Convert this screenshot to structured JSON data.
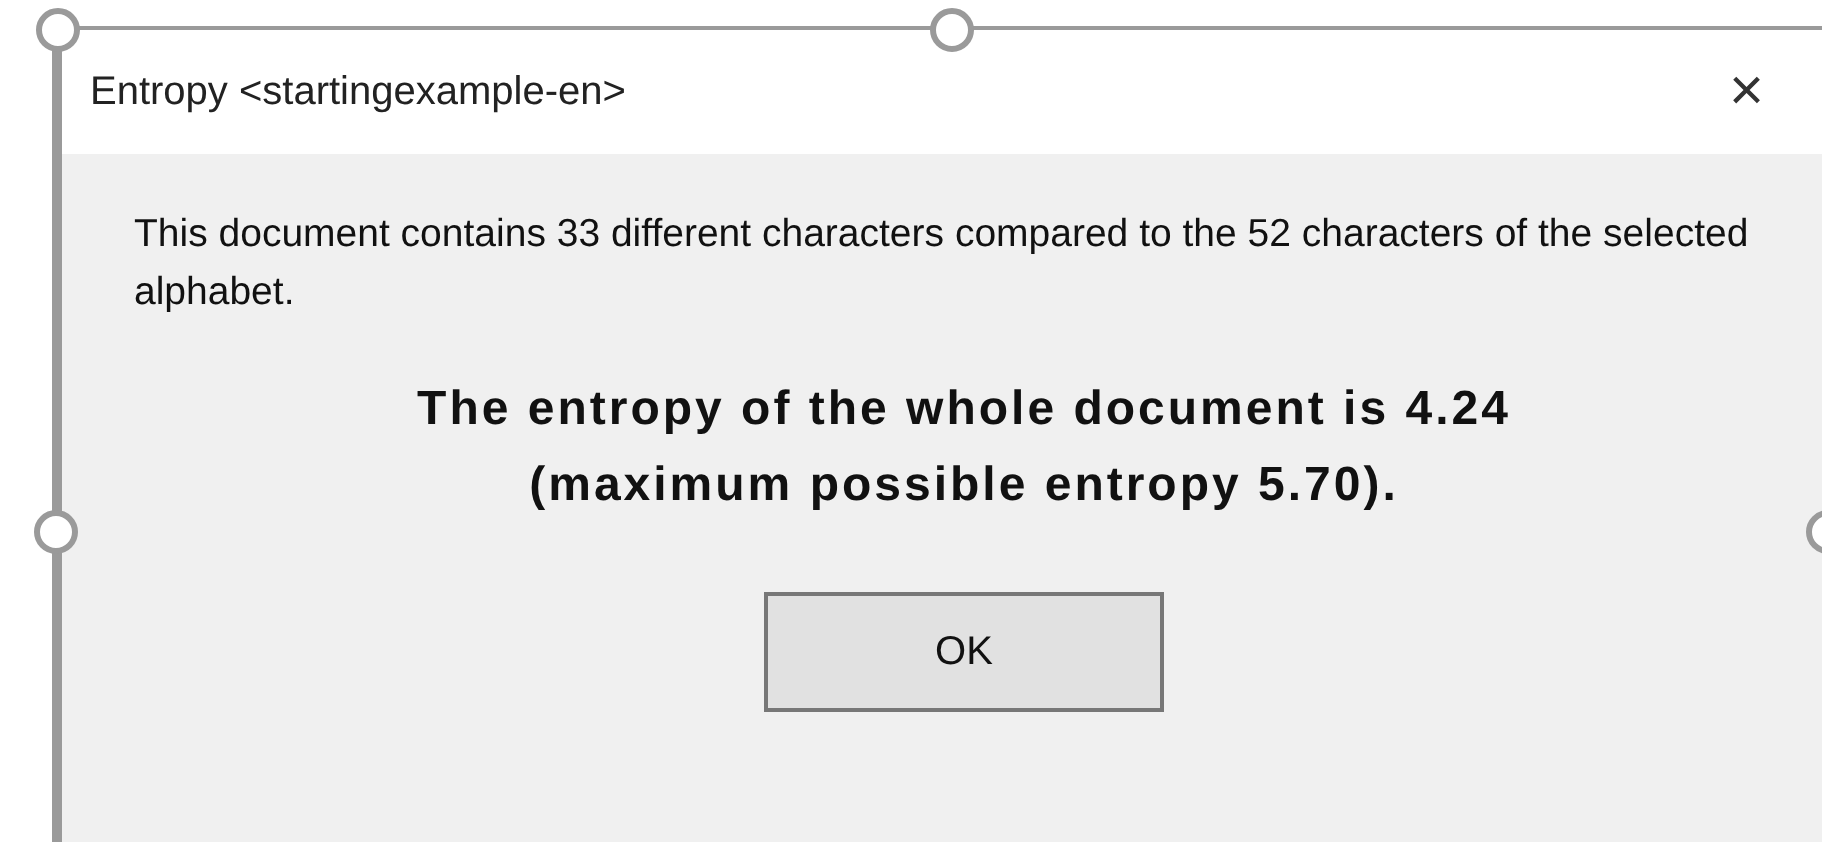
{
  "window": {
    "title": "Entropy <startingexample-en>",
    "close": "×"
  },
  "message": "This document contains 33 different characters compared to the 52 characters of the selected alphabet.",
  "result": [
    "The entropy of the whole document is 4.24",
    "(maximum possible entropy 5.70)."
  ],
  "buttons": [
    "OK"
  ]
}
